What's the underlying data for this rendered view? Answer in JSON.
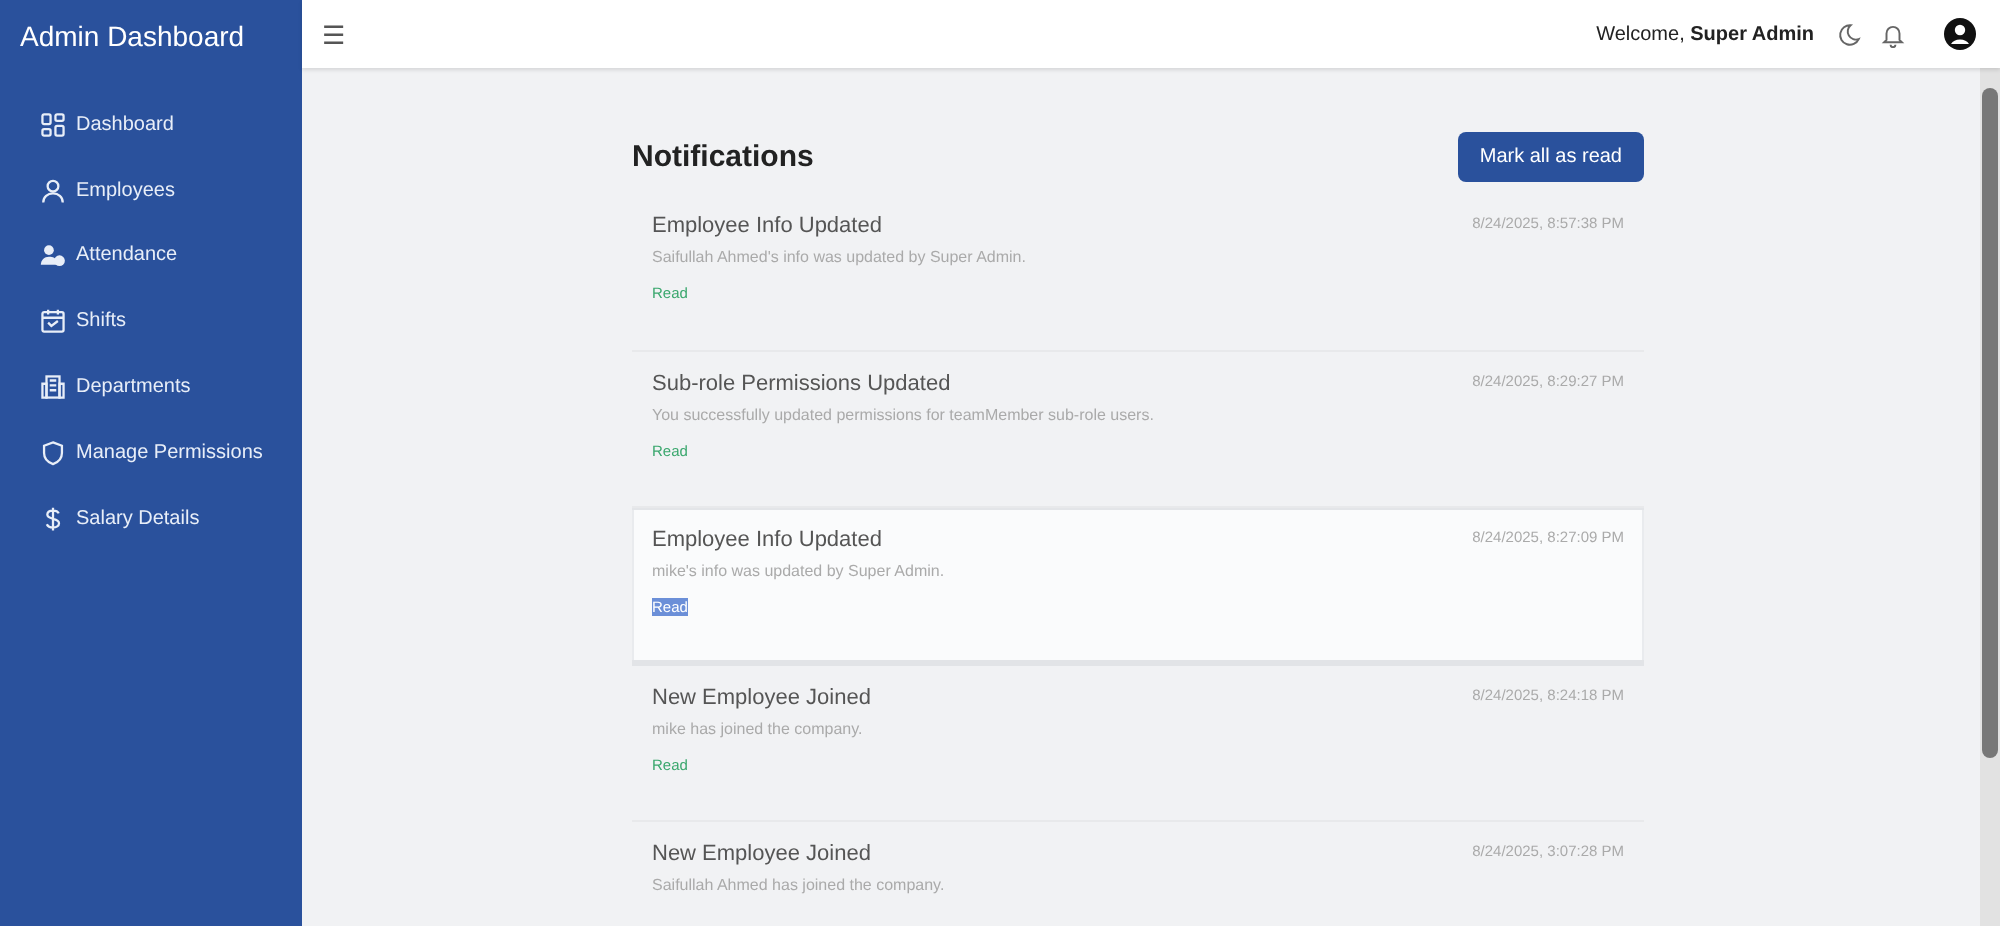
{
  "sidebar": {
    "title": "Admin Dashboard",
    "items": [
      {
        "label": "Dashboard"
      },
      {
        "label": "Employees"
      },
      {
        "label": "Attendance"
      },
      {
        "label": "Shifts"
      },
      {
        "label": "Departments"
      },
      {
        "label": "Manage Permissions"
      },
      {
        "label": "Salary Details"
      }
    ]
  },
  "header": {
    "menu_icon": "☰",
    "welcome": "Welcome, **Super Admin**"
  },
  "notifications": {
    "title": "Notifications",
    "mark_all_button": "Mark all as read",
    "items": [
      {
        "title": "Employee Info Updated",
        "message": "Saifullah Ahmed's info was updated by Super Admin.",
        "time": "8/24/2025, 8:57:38 PM",
        "status": "Read",
        "highlighted": false
      },
      {
        "title": "Sub-role Permissions Updated",
        "message": "You successfully updated permissions for teamMember sub-role users.",
        "time": "8/24/2025, 8:29:27 PM",
        "status": "Read",
        "highlighted": false
      },
      {
        "title": "Employee Info Updated",
        "message": "mike's info was updated by Super Admin.",
        "time": "8/24/2025, 8:27:09 PM",
        "status": "Read",
        "highlighted": true
      },
      {
        "title": "New Employee Joined",
        "message": "mike has joined the company.",
        "time": "8/24/2025, 8:24:18 PM",
        "status": "Read",
        "highlighted": false
      },
      {
        "title": "New Employee Joined",
        "message": "Saifullah Ahmed has joined the company.",
        "time": "8/24/2025, 3:07:28 PM",
        "highlighted": false
      }
    ]
  }
}
